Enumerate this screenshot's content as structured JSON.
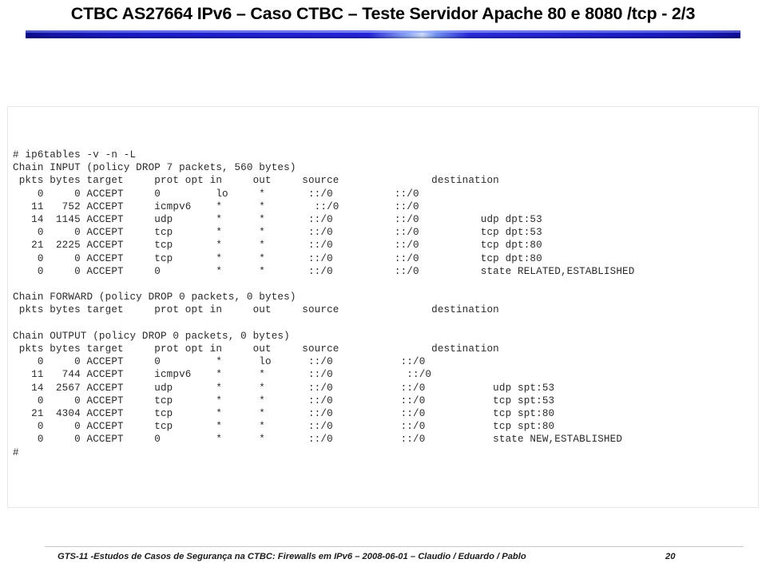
{
  "slide": {
    "title": "CTBC AS27664 IPv6 – Caso CTBC – Teste Servidor Apache 80 e 8080 /tcp - 2/3",
    "accent_color": "#2020d0"
  },
  "terminal": {
    "lines": [
      "# ip6tables -v -n -L",
      "Chain INPUT (policy DROP 7 packets, 560 bytes)",
      " pkts bytes target     prot opt in     out     source               destination",
      "    0     0 ACCEPT     0         lo     *       ::/0          ::/0",
      "   11   752 ACCEPT     icmpv6    *      *        ::/0         ::/0",
      "   14  1145 ACCEPT     udp       *      *       ::/0          ::/0          udp dpt:53",
      "    0     0 ACCEPT     tcp       *      *       ::/0          ::/0          tcp dpt:53",
      "   21  2225 ACCEPT     tcp       *      *       ::/0          ::/0          tcp dpt:80",
      "    0     0 ACCEPT     tcp       *      *       ::/0          ::/0          tcp dpt:80",
      "    0     0 ACCEPT     0         *      *       ::/0          ::/0          state RELATED,ESTABLISHED",
      "",
      "Chain FORWARD (policy DROP 0 packets, 0 bytes)",
      " pkts bytes target     prot opt in     out     source               destination",
      "",
      "Chain OUTPUT (policy DROP 0 packets, 0 bytes)",
      " pkts bytes target     prot opt in     out     source               destination",
      "    0     0 ACCEPT     0         *      lo      ::/0           ::/0",
      "   11   744 ACCEPT     icmpv6    *      *       ::/0            ::/0",
      "   14  2567 ACCEPT     udp       *      *       ::/0           ::/0           udp spt:53",
      "    0     0 ACCEPT     tcp       *      *       ::/0           ::/0           tcp spt:53",
      "   21  4304 ACCEPT     tcp       *      *       ::/0           ::/0           tcp spt:80",
      "    0     0 ACCEPT     tcp       *      *       ::/0           ::/0           tcp spt:80",
      "    0     0 ACCEPT     0         *      *       ::/0           ::/0           state NEW,ESTABLISHED",
      "#"
    ],
    "command": "# ip6tables -v -n -L",
    "chains": [
      {
        "name": "INPUT",
        "policy": "DROP",
        "packets": 7,
        "bytes": 560,
        "columns": [
          "pkts",
          "bytes",
          "target",
          "prot",
          "opt",
          "in",
          "out",
          "source",
          "destination"
        ],
        "rules": [
          {
            "pkts": 0,
            "bytes": 0,
            "target": "ACCEPT",
            "prot": "0",
            "opt": "",
            "in": "lo",
            "out": "*",
            "source": "::/0",
            "destination": "::/0",
            "extra": ""
          },
          {
            "pkts": 11,
            "bytes": 752,
            "target": "ACCEPT",
            "prot": "icmpv6",
            "opt": "",
            "in": "*",
            "out": "*",
            "source": "::/0",
            "destination": "::/0",
            "extra": ""
          },
          {
            "pkts": 14,
            "bytes": 1145,
            "target": "ACCEPT",
            "prot": "udp",
            "opt": "",
            "in": "*",
            "out": "*",
            "source": "::/0",
            "destination": "::/0",
            "extra": "udp dpt:53"
          },
          {
            "pkts": 0,
            "bytes": 0,
            "target": "ACCEPT",
            "prot": "tcp",
            "opt": "",
            "in": "*",
            "out": "*",
            "source": "::/0",
            "destination": "::/0",
            "extra": "tcp dpt:53"
          },
          {
            "pkts": 21,
            "bytes": 2225,
            "target": "ACCEPT",
            "prot": "tcp",
            "opt": "",
            "in": "*",
            "out": "*",
            "source": "::/0",
            "destination": "::/0",
            "extra": "tcp dpt:80"
          },
          {
            "pkts": 0,
            "bytes": 0,
            "target": "ACCEPT",
            "prot": "tcp",
            "opt": "",
            "in": "*",
            "out": "*",
            "source": "::/0",
            "destination": "::/0",
            "extra": "tcp dpt:80"
          },
          {
            "pkts": 0,
            "bytes": 0,
            "target": "ACCEPT",
            "prot": "0",
            "opt": "",
            "in": "*",
            "out": "*",
            "source": "::/0",
            "destination": "::/0",
            "extra": "state RELATED,ESTABLISHED"
          }
        ]
      },
      {
        "name": "FORWARD",
        "policy": "DROP",
        "packets": 0,
        "bytes": 0,
        "columns": [
          "pkts",
          "bytes",
          "target",
          "prot",
          "opt",
          "in",
          "out",
          "source",
          "destination"
        ],
        "rules": []
      },
      {
        "name": "OUTPUT",
        "policy": "DROP",
        "packets": 0,
        "bytes": 0,
        "columns": [
          "pkts",
          "bytes",
          "target",
          "prot",
          "opt",
          "in",
          "out",
          "source",
          "destination"
        ],
        "rules": [
          {
            "pkts": 0,
            "bytes": 0,
            "target": "ACCEPT",
            "prot": "0",
            "opt": "",
            "in": "*",
            "out": "lo",
            "source": "::/0",
            "destination": "::/0",
            "extra": ""
          },
          {
            "pkts": 11,
            "bytes": 744,
            "target": "ACCEPT",
            "prot": "icmpv6",
            "opt": "",
            "in": "*",
            "out": "*",
            "source": "::/0",
            "destination": "::/0",
            "extra": ""
          },
          {
            "pkts": 14,
            "bytes": 2567,
            "target": "ACCEPT",
            "prot": "udp",
            "opt": "",
            "in": "*",
            "out": "*",
            "source": "::/0",
            "destination": "::/0",
            "extra": "udp spt:53"
          },
          {
            "pkts": 0,
            "bytes": 0,
            "target": "ACCEPT",
            "prot": "tcp",
            "opt": "",
            "in": "*",
            "out": "*",
            "source": "::/0",
            "destination": "::/0",
            "extra": "tcp spt:53"
          },
          {
            "pkts": 21,
            "bytes": 4304,
            "target": "ACCEPT",
            "prot": "tcp",
            "opt": "",
            "in": "*",
            "out": "*",
            "source": "::/0",
            "destination": "::/0",
            "extra": "tcp spt:80"
          },
          {
            "pkts": 0,
            "bytes": 0,
            "target": "ACCEPT",
            "prot": "tcp",
            "opt": "",
            "in": "*",
            "out": "*",
            "source": "::/0",
            "destination": "::/0",
            "extra": "tcp spt:80"
          },
          {
            "pkts": 0,
            "bytes": 0,
            "target": "ACCEPT",
            "prot": "0",
            "opt": "",
            "in": "*",
            "out": "*",
            "source": "::/0",
            "destination": "::/0",
            "extra": "state NEW,ESTABLISHED"
          }
        ]
      }
    ],
    "prompt": "#"
  },
  "footer": {
    "text": "GTS-11 -Estudos de Casos de Segurança na CTBC: Firewalls em IPv6  – 2008-06-01 – Claudio / Eduardo / Pablo",
    "page": "20"
  }
}
